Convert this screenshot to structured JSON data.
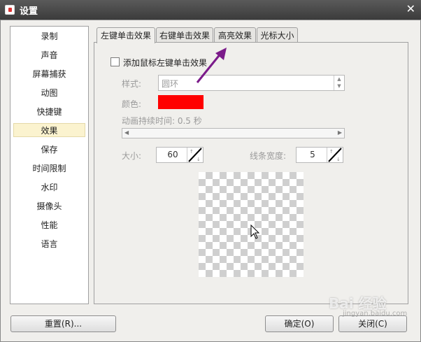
{
  "window": {
    "title": "设置"
  },
  "sidebar": {
    "items": [
      {
        "label": "录制"
      },
      {
        "label": "声音"
      },
      {
        "label": "屏幕捕获"
      },
      {
        "label": "动图"
      },
      {
        "label": "快捷键"
      },
      {
        "label": "效果",
        "active": true
      },
      {
        "label": "保存"
      },
      {
        "label": "时间限制"
      },
      {
        "label": "水印"
      },
      {
        "label": "摄像头"
      },
      {
        "label": "性能"
      },
      {
        "label": "语言"
      }
    ]
  },
  "tabs": [
    {
      "label": "左键单击效果",
      "active": true
    },
    {
      "label": "右键单击效果"
    },
    {
      "label": "高亮效果"
    },
    {
      "label": "光标大小"
    }
  ],
  "effect": {
    "enable_label": "添加鼠标左键单击效果",
    "enabled": false,
    "style_label": "样式:",
    "style_value": "圆环",
    "color_label": "颜色:",
    "color_value": "#ff0000",
    "duration_label": "动画持续时间: 0.5 秒",
    "duration_fraction": 0.0,
    "size_label": "大小:",
    "size_value": "60",
    "line_width_label": "线条宽度:",
    "line_width_value": "5"
  },
  "buttons": {
    "reset": "重置(R)...",
    "ok": "确定(O)",
    "close": "关闭(C)"
  },
  "watermark": {
    "main": "Bai 经验",
    "sub": "jingyan.baidu.com"
  },
  "colors": {
    "annotation_arrow": "#7b1b8a",
    "active_item_bg": "#fbf3cf"
  }
}
